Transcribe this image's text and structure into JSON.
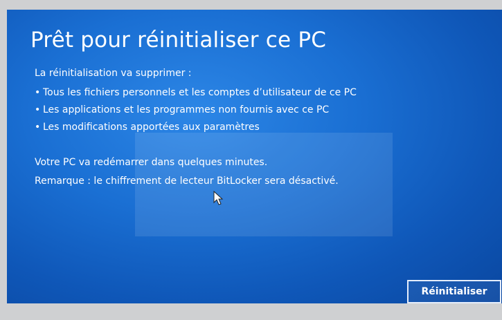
{
  "dialog": {
    "title": "Prêt pour réinitialiser ce PC",
    "intro": "La réinitialisation va supprimer :",
    "bullet_glyph": "•",
    "items": [
      {
        "label": "Tous les fichiers personnels et les comptes d’utilisateur de ce PC"
      },
      {
        "label": "Les applications et les programmes non fournis avec ce PC"
      },
      {
        "label": "Les modifications apportées aux paramètres"
      }
    ],
    "restart_note": "Votre PC va redémarrer dans quelques minutes.",
    "bitlocker_note": "Remarque : le chiffrement de lecteur BitLocker sera désactivé.",
    "reset_button_label": "Réinitialiser"
  },
  "theme": {
    "background": "#1a6fd3",
    "text": "#ffffff",
    "button_border": "#e6eefc"
  },
  "icons": {
    "cursor": "mouse-pointer-icon"
  }
}
